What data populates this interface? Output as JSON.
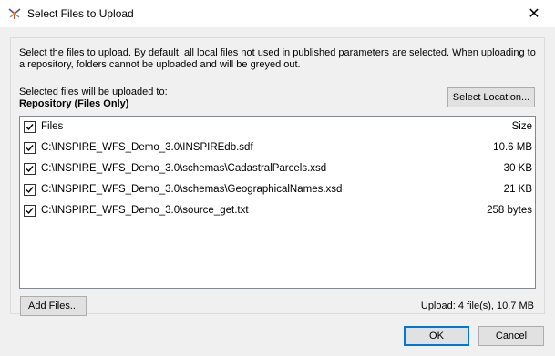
{
  "window": {
    "title": "Select Files to Upload",
    "close_glyph": "✕",
    "icon": "fme-workbench-icon"
  },
  "instructions": "Select the files to upload. By default, all local files not used in published parameters are selected. When uploading to a repository, folders cannot be uploaded and will be greyed out.",
  "destination": {
    "label": "Selected files will be uploaded to:",
    "value": "Repository (Files Only)"
  },
  "select_location_label": "Select Location...",
  "file_list": {
    "header": {
      "files_label": "Files",
      "size_label": "Size",
      "checked": true
    },
    "rows": [
      {
        "path": "C:\\INSPIRE_WFS_Demo_3.0\\INSPIREdb.sdf",
        "size": "10.6 MB",
        "checked": true
      },
      {
        "path": "C:\\INSPIRE_WFS_Demo_3.0\\schemas\\CadastralParcels.xsd",
        "size": "30 KB",
        "checked": true
      },
      {
        "path": "C:\\INSPIRE_WFS_Demo_3.0\\schemas\\GeographicalNames.xsd",
        "size": "21 KB",
        "checked": true
      },
      {
        "path": "C:\\INSPIRE_WFS_Demo_3.0\\source_get.txt",
        "size": "258 bytes",
        "checked": true
      }
    ]
  },
  "add_files_label": "Add Files...",
  "upload_summary": "Upload: 4 file(s), 10.7 MB",
  "buttons": {
    "ok": "OK",
    "cancel": "Cancel"
  },
  "colors": {
    "default_button_border": "#0078d7",
    "client_bg": "#f0f0f0"
  }
}
